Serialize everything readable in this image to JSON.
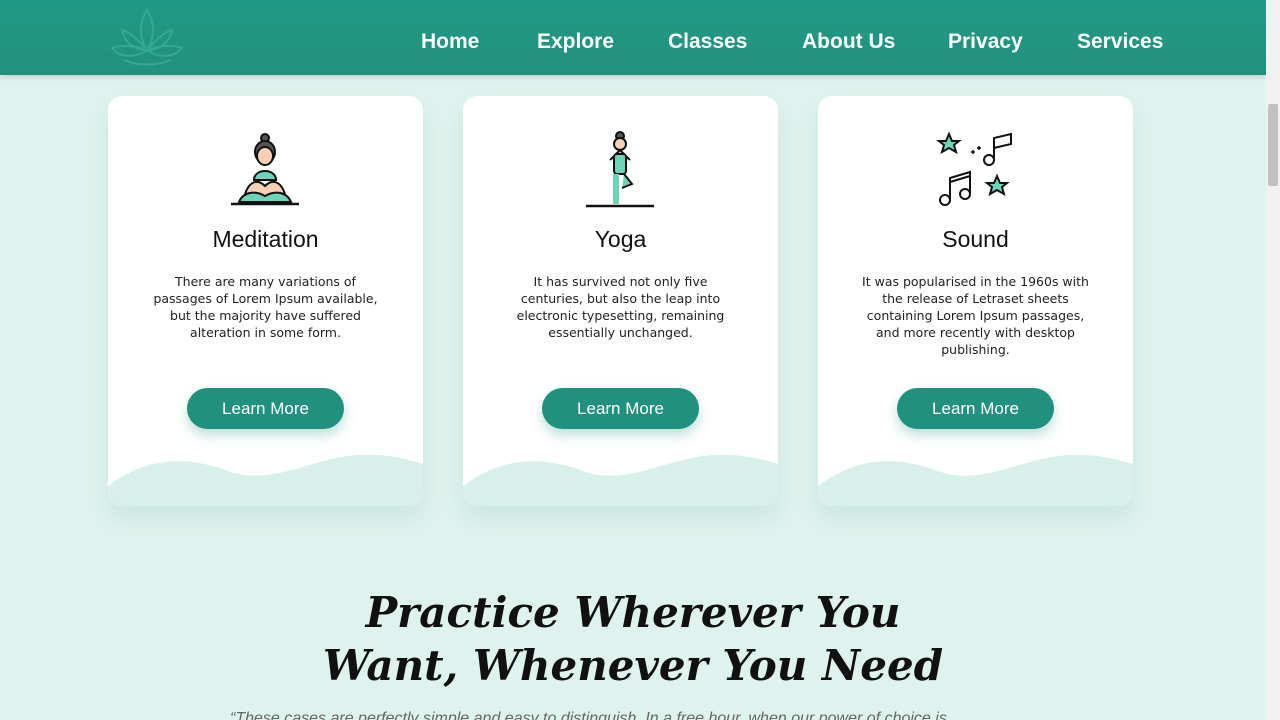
{
  "nav": {
    "logo_icon": "lotus-icon",
    "links": [
      "Home",
      "Explore",
      "Classes",
      "About Us",
      "Privacy",
      "Services"
    ]
  },
  "cards": [
    {
      "icon": "meditation-icon",
      "title": "Meditation",
      "text": "There are many variations of passages of Lorem Ipsum available, but the majority have suffered alteration in some form.",
      "button": "Learn More"
    },
    {
      "icon": "yoga-icon",
      "title": "Yoga",
      "text": "It has survived not only five centuries, but also the leap into electronic typesetting, remaining essentially unchanged.",
      "button": "Learn More"
    },
    {
      "icon": "music-notes-icon",
      "title": "Sound",
      "text": "It was popularised in the 1960s with the release of Letraset sheets containing Lorem Ipsum passages, and more recently with desktop publishing.",
      "button": "Learn More"
    }
  ],
  "section": {
    "title_line1": "Practice Wherever You",
    "title_line2": "Want, Whenever You Need",
    "quote": "“These cases are perfectly simple and easy to distinguish. In a free hour, when our power of choice is"
  },
  "colors": {
    "primary": "#21917f",
    "background": "#dff3ee",
    "wave": "#d8f0ea"
  }
}
